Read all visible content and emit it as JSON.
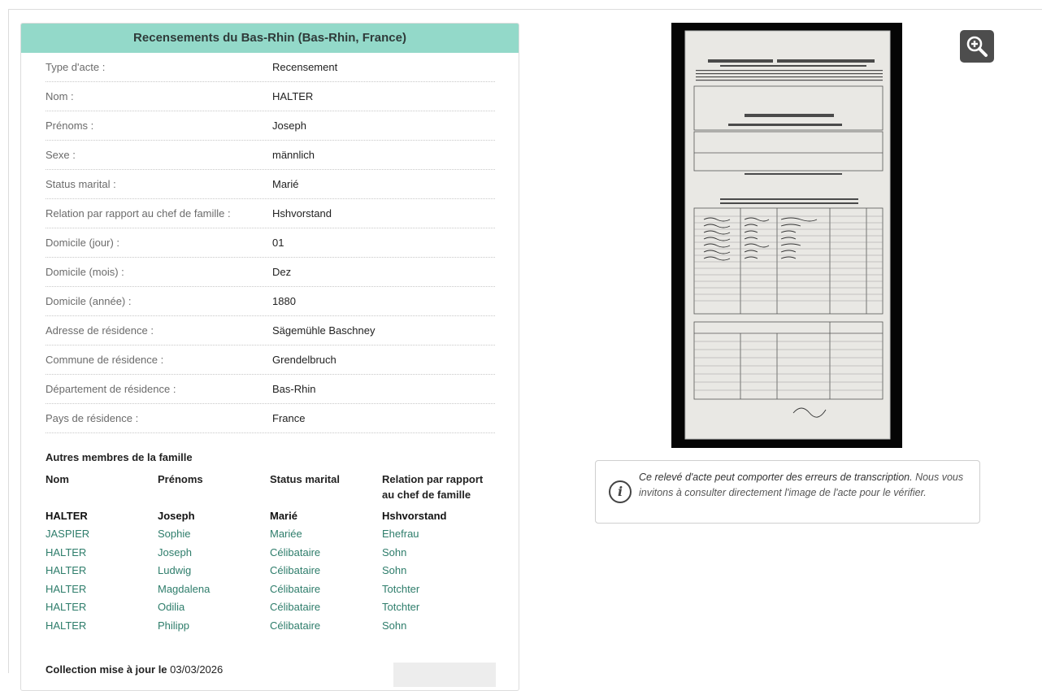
{
  "card": {
    "title": "Recensements du Bas-Rhin (Bas-Rhin, France)",
    "fields": [
      {
        "label": "Type d'acte :",
        "value": "Recensement"
      },
      {
        "label": "Nom :",
        "value": "HALTER"
      },
      {
        "label": "Prénoms :",
        "value": "Joseph"
      },
      {
        "label": "Sexe :",
        "value": "männlich"
      },
      {
        "label": "Status marital :",
        "value": "Marié"
      },
      {
        "label": "Relation par rapport au chef de famille :",
        "value": "Hshvorstand"
      },
      {
        "label": "Domicile (jour) :",
        "value": "01"
      },
      {
        "label": "Domicile (mois) :",
        "value": "Dez"
      },
      {
        "label": "Domicile (année) :",
        "value": "1880"
      },
      {
        "label": "Adresse de résidence :",
        "value": "Sägemühle Baschney"
      },
      {
        "label": "Commune de résidence :",
        "value": "Grendelbruch"
      },
      {
        "label": "Département de résidence :",
        "value": "Bas-Rhin"
      },
      {
        "label": "Pays de résidence  :",
        "value": "France"
      }
    ]
  },
  "family": {
    "title": "Autres membres de la famille",
    "headers": {
      "nom": "Nom",
      "prenoms": "Prénoms",
      "status": "Status marital",
      "relation": "Relation par rapport au chef de famille"
    },
    "main": {
      "nom": "HALTER",
      "prenoms": "Joseph",
      "status": "Marié",
      "relation": "Hshvorstand"
    },
    "members": [
      {
        "nom": "JASPIER",
        "prenoms": "Sophie",
        "status": "Mariée",
        "relation": "Ehefrau"
      },
      {
        "nom": "HALTER",
        "prenoms": "Joseph",
        "status": "Célibataire",
        "relation": "Sohn"
      },
      {
        "nom": "HALTER",
        "prenoms": "Ludwig",
        "status": "Célibataire",
        "relation": "Sohn"
      },
      {
        "nom": "HALTER",
        "prenoms": "Magdalena",
        "status": "Célibataire",
        "relation": "Totchter"
      },
      {
        "nom": "HALTER",
        "prenoms": "Odilia",
        "status": "Célibataire",
        "relation": "Totchter"
      },
      {
        "nom": "HALTER",
        "prenoms": "Philipp",
        "status": "Célibataire",
        "relation": "Sohn"
      }
    ]
  },
  "collection": {
    "label": "Collection mise à jour le",
    "date": "03/03/2026"
  },
  "zoom": {
    "icon": "zoom-in-icon"
  },
  "notice": {
    "icon": "info-icon",
    "strong": "Ce relevé d'acte peut comporter des erreurs de transcription.",
    "rest": " Nous vous invitons à consulter directement l'image de l'acte pour le vérifier."
  },
  "colors": {
    "header_bg": "#93d9c9",
    "member_text": "#2e7d6b"
  }
}
